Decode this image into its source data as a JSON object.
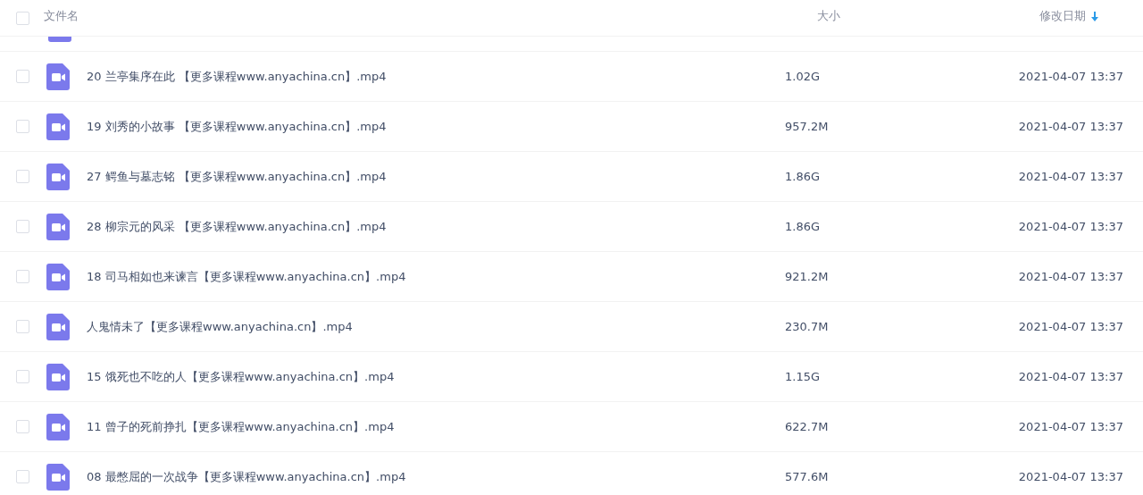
{
  "header": {
    "checked": false,
    "columns": [
      {
        "label": "文件名"
      },
      {
        "label": "大小"
      },
      {
        "label": "修改日期",
        "sorted": true
      }
    ]
  },
  "files": [
    {
      "name": "20 兰亭集序在此 【更多课程www.anyachina.cn】.mp4",
      "size": "1.02G",
      "modified": "2021-04-07 13:37",
      "checked": false
    },
    {
      "name": "19 刘秀的小故事 【更多课程www.anyachina.cn】.mp4",
      "size": "957.2M",
      "modified": "2021-04-07 13:37",
      "checked": false
    },
    {
      "name": "27 鳄鱼与墓志铭 【更多课程www.anyachina.cn】.mp4",
      "size": "1.86G",
      "modified": "2021-04-07 13:37",
      "checked": false
    },
    {
      "name": "28 柳宗元的风采 【更多课程www.anyachina.cn】.mp4",
      "size": "1.86G",
      "modified": "2021-04-07 13:37",
      "checked": false
    },
    {
      "name": "18 司马相如也来谏言【更多课程www.anyachina.cn】.mp4",
      "size": "921.2M",
      "modified": "2021-04-07 13:37",
      "checked": false
    },
    {
      "name": "人鬼情未了【更多课程www.anyachina.cn】.mp4",
      "size": "230.7M",
      "modified": "2021-04-07 13:37",
      "checked": false
    },
    {
      "name": "15 饿死也不吃的人【更多课程www.anyachina.cn】.mp4",
      "size": "1.15G",
      "modified": "2021-04-07 13:37",
      "checked": false
    },
    {
      "name": "11 曾子的死前挣扎【更多课程www.anyachina.cn】.mp4",
      "size": "622.7M",
      "modified": "2021-04-07 13:37",
      "checked": false
    },
    {
      "name": "08 最憋屈的一次战争【更多课程www.anyachina.cn】.mp4",
      "size": "577.6M",
      "modified": "2021-04-07 13:37",
      "checked": false
    }
  ]
}
